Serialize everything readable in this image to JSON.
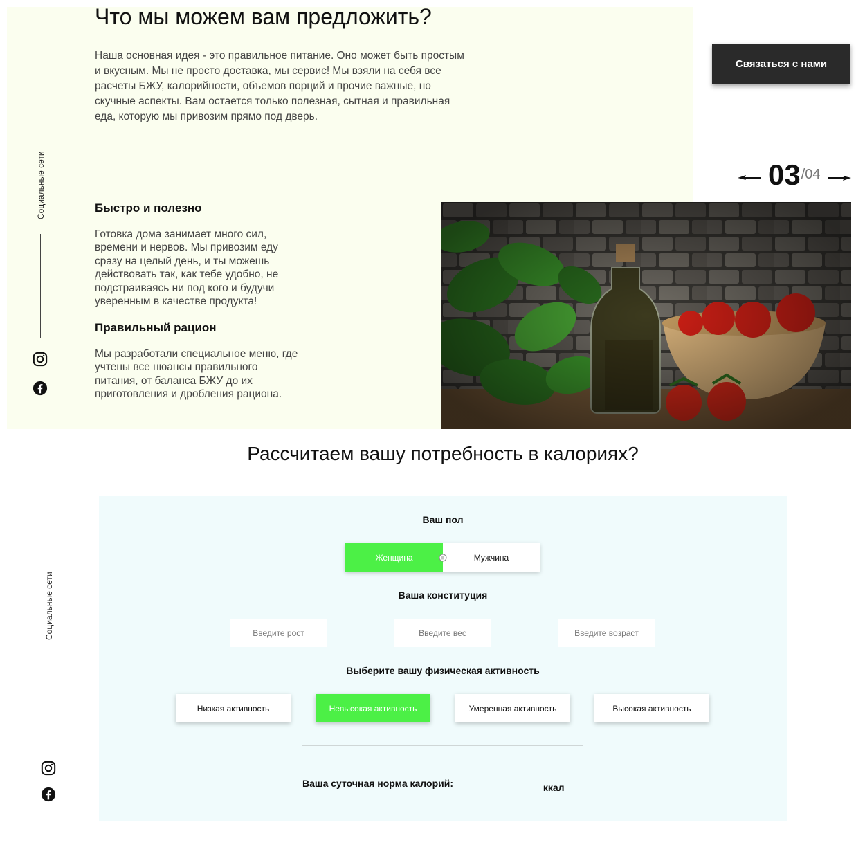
{
  "offer": {
    "title": "Что мы можем вам предложить?",
    "intro": "Наша основная идея - это правильное питание. Оно может быть простым и вкусным. Мы не просто доставка, мы сервис! Мы взяли на себя все расчеты БЖУ, калорийности, объемов порций и прочие важные, но скучные аспекты. Вам остается только полезная, сытная и правильная еда, которую мы привозим прямо под дверь.",
    "features": [
      {
        "title": "Быстро и полезно",
        "text": "Готовка дома занимает много сил, времени и нервов. Мы привозим еду сразу на целый день, и ты можешь действовать так, как тебе удобно, не подстраиваясь ни под кого и будучи уверенным в качестве продукта!"
      },
      {
        "title": "Правильный рацион",
        "text": "Мы разработали специальное меню, где учтены все нюансы правильного питания, от баланса БЖУ до их приготовления и дробления рациона."
      }
    ]
  },
  "social": {
    "label": "Социальные сети",
    "icons": [
      "instagram-icon",
      "facebook-icon"
    ]
  },
  "contact_button": "Связаться с нами",
  "slider": {
    "current": "03",
    "total": "/04"
  },
  "calculator": {
    "title": "Рассчитаем вашу потребность в калориях?",
    "gender_label": "Ваш пол",
    "gender_options": [
      "Женщина",
      "Мужчина"
    ],
    "gender_selected": "Женщина",
    "constitution_label": "Ваша конституция",
    "fields": [
      {
        "placeholder": "Введите рост"
      },
      {
        "placeholder": "Введите вес"
      },
      {
        "placeholder": "Введите возраст"
      }
    ],
    "activity_label": "Выберите вашу физическая активность",
    "activities": [
      "Низкая активность",
      "Невысокая активность",
      "Умеренная активность",
      "Высокая активность"
    ],
    "activity_selected": "Невысокая активность",
    "result_label": "Ваша суточная норма калорий:",
    "result_value": "_____",
    "result_unit": "ккал"
  },
  "colors": {
    "accent": "#4cf046",
    "hero_bg": "#fbfeef",
    "calc_bg": "#f0fbfc",
    "dark_button": "#2a2a2a"
  }
}
